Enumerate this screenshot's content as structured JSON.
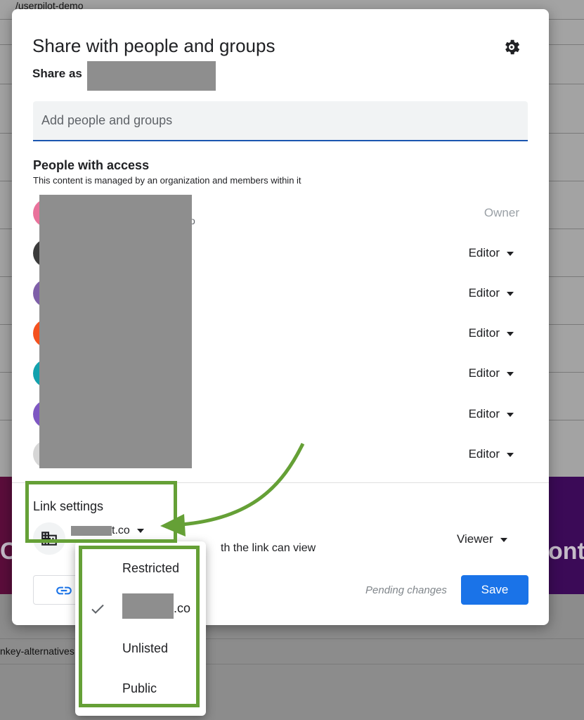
{
  "background": {
    "url_fragment": "/userpilot-demo",
    "left_word": "C",
    "right_word": "ont",
    "alt_text": "nkey-alternatives"
  },
  "dialog": {
    "title": "Share with people and groups",
    "share_as_label": "Share as",
    "settings_icon": "gear-icon"
  },
  "add_field": {
    "placeholder": "Add people and groups"
  },
  "access": {
    "heading": "People with access",
    "subtitle": "This content is managed by an organization and members within it",
    "people": [
      {
        "role": "Owner",
        "fragment": "o",
        "avatar_color": "#e9729b"
      },
      {
        "role": "Editor",
        "avatar_color": "#3b3b3b"
      },
      {
        "role": "Editor",
        "avatar_color": "#7e5fa8"
      },
      {
        "role": "Editor",
        "avatar_color": "#f4511e"
      },
      {
        "role": "Editor",
        "avatar_color": "#12a1ad"
      },
      {
        "role": "Editor",
        "avatar_color": "#7e57c2"
      },
      {
        "role": "Editor",
        "avatar_color": "#d6d6d6"
      }
    ]
  },
  "link_settings": {
    "heading": "Link settings",
    "domain_suffix": "t.co",
    "description": "th the link can view",
    "permission": "Viewer",
    "icon": "building-icon"
  },
  "footer": {
    "copy_icon": "link-icon",
    "pending": "Pending changes",
    "save": "Save"
  },
  "menu": {
    "items": [
      {
        "label": "Restricted",
        "checked": false
      },
      {
        "label": ".co",
        "checked": true
      },
      {
        "label": "Unlisted",
        "checked": false
      },
      {
        "label": "Public",
        "checked": false
      }
    ]
  },
  "colors": {
    "accent": "#1a73e8",
    "annotation": "#65a036"
  }
}
